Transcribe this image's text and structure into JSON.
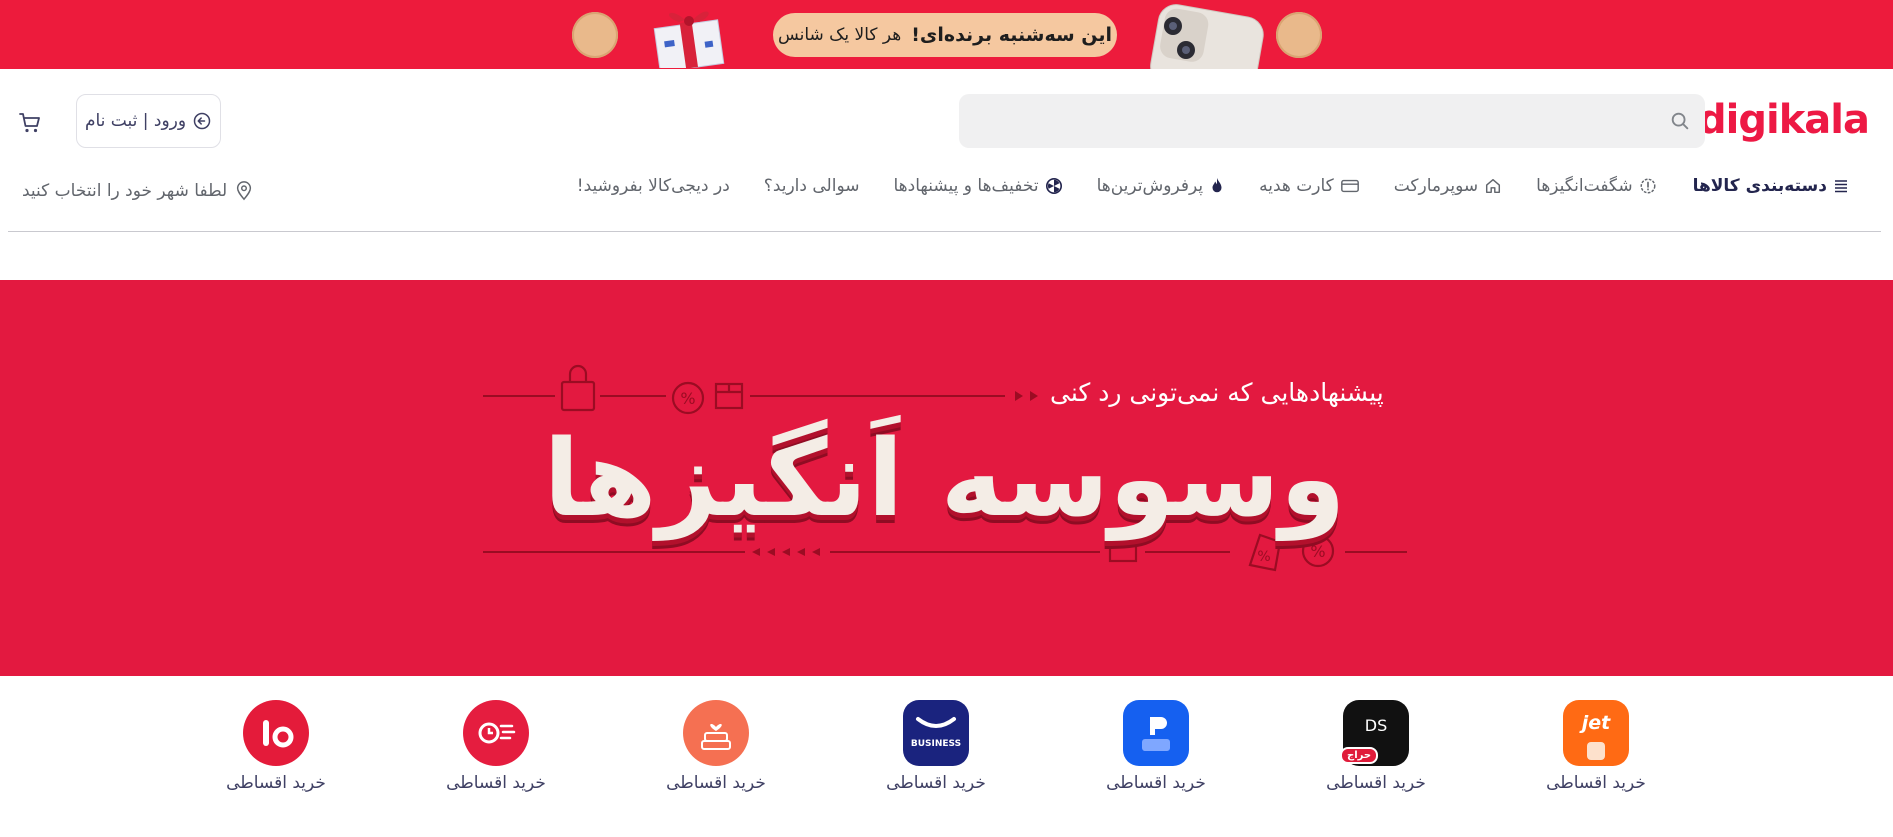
{
  "promo": {
    "headline": "این سه‌شنبه برنده‌ای!",
    "subline": "هر کالا یک شانس"
  },
  "header": {
    "logo": "digikala",
    "search_placeholder": "",
    "login_label": "ورود | ثبت نام",
    "city_label": "لطفا شهر خود را انتخاب کنید"
  },
  "nav": {
    "items": [
      {
        "label": "دسته‌بندی کالاها",
        "icon": "menu-icon"
      },
      {
        "label": "شگفت‌انگیزها",
        "icon": "amazing-icon"
      },
      {
        "label": "سوپرمارکت",
        "icon": "supermarket-icon"
      },
      {
        "label": "کارت هدیه",
        "icon": "gift-card-icon"
      },
      {
        "label": "پرفروش‌ترین‌ها",
        "icon": "fire-icon"
      },
      {
        "label": "تخفیف‌ها و پیشنهادها",
        "icon": "discount-icon"
      },
      {
        "label": "سوالی دارید؟",
        "icon": ""
      },
      {
        "label": "در دیجی‌کالا بفروشید!",
        "icon": ""
      }
    ]
  },
  "hero": {
    "subtitle": "پیشنهادهایی که نمی‌تونی رد کنی",
    "title": "وسوسه اَنگیزها"
  },
  "services": {
    "items": [
      {
        "label": "خرید اقساطی",
        "icon": "jet-icon",
        "badge": "jet",
        "color": "#ff6a14"
      },
      {
        "label": "خرید اقساطی",
        "icon": "digistyle-icon",
        "badge": "DS",
        "tag": "حراج",
        "color": "#111111"
      },
      {
        "label": "خرید اقساطی",
        "icon": "digipay-icon",
        "badge": "",
        "color": "#1560f0"
      },
      {
        "label": "خرید اقساطی",
        "icon": "business-icon",
        "badge": "BUSINESS",
        "color": "#1a237e"
      },
      {
        "label": "خرید اقساطی",
        "icon": "cake-icon",
        "badge": "",
        "color": "#f57052"
      },
      {
        "label": "خرید اقساطی",
        "icon": "express-icon",
        "badge": "",
        "color": "#e51d3f"
      },
      {
        "label": "خرید اقساطی",
        "icon": "installment-icon",
        "badge": "",
        "color": "#e41b3a"
      }
    ]
  },
  "colors": {
    "brand": "#ed1944",
    "hero_bg": "#e31940",
    "promo_bg": "#ed1b3c"
  }
}
